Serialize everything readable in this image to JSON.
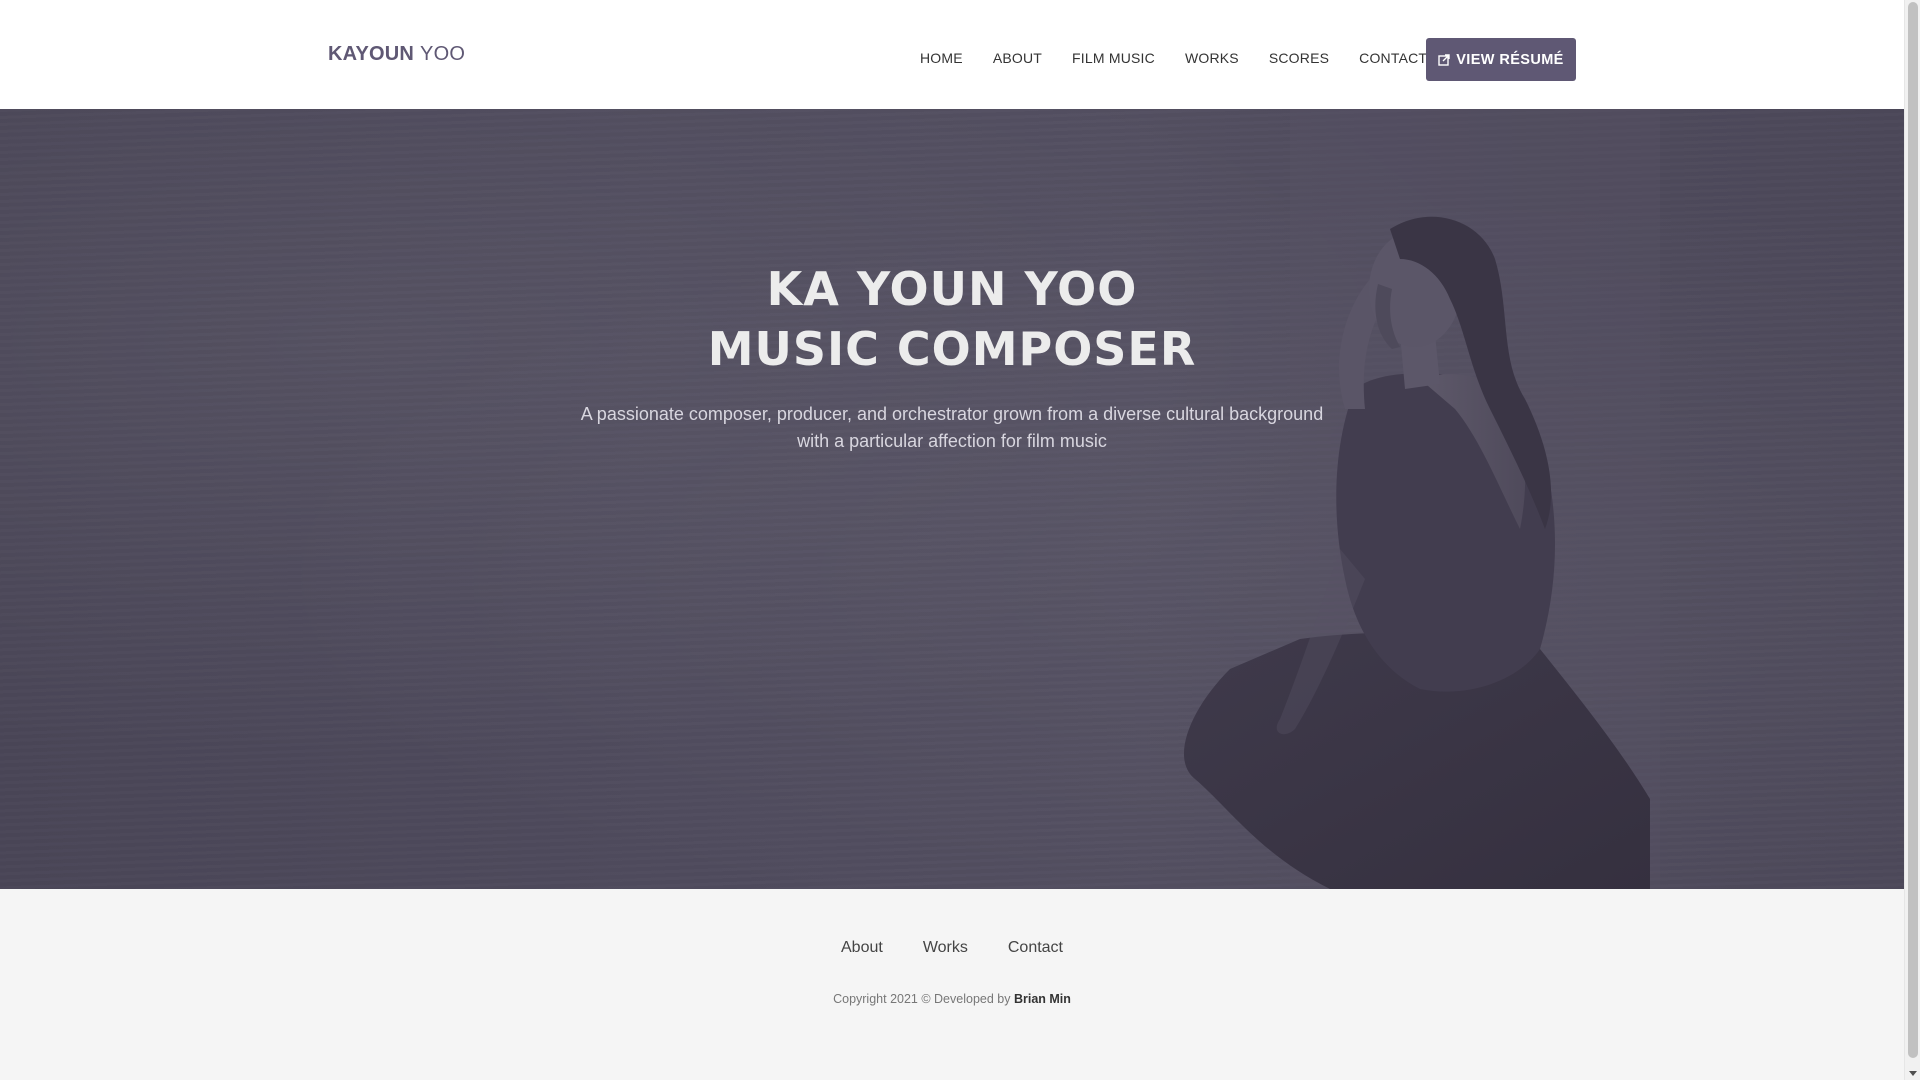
{
  "header": {
    "brand_first": "KAYOUN",
    "brand_last": "YOO",
    "nav": [
      "HOME",
      "ABOUT",
      "FILM MUSIC",
      "WORKS",
      "SCORES",
      "CONTACT"
    ],
    "resume_button": "VIEW RÉSUMÉ",
    "resume_icon": "external-link-icon"
  },
  "hero": {
    "title_line1": "KA YOUN YOO",
    "title_line2": "MUSIC COMPOSER",
    "subtitle_line1": "A passionate composer, producer, and orchestrator grown from a diverse cultural background",
    "subtitle_line2": "with a particular affection for film music"
  },
  "footer": {
    "nav": [
      "About",
      "Works",
      "Contact"
    ],
    "copyright_prefix": "Copyright 2021 © Developed by",
    "developer": "Brian Min"
  },
  "colors": {
    "accent": "#5f5874",
    "hero_overlay": "#4e4a5c",
    "footer_bg": "#f5f5f5"
  }
}
